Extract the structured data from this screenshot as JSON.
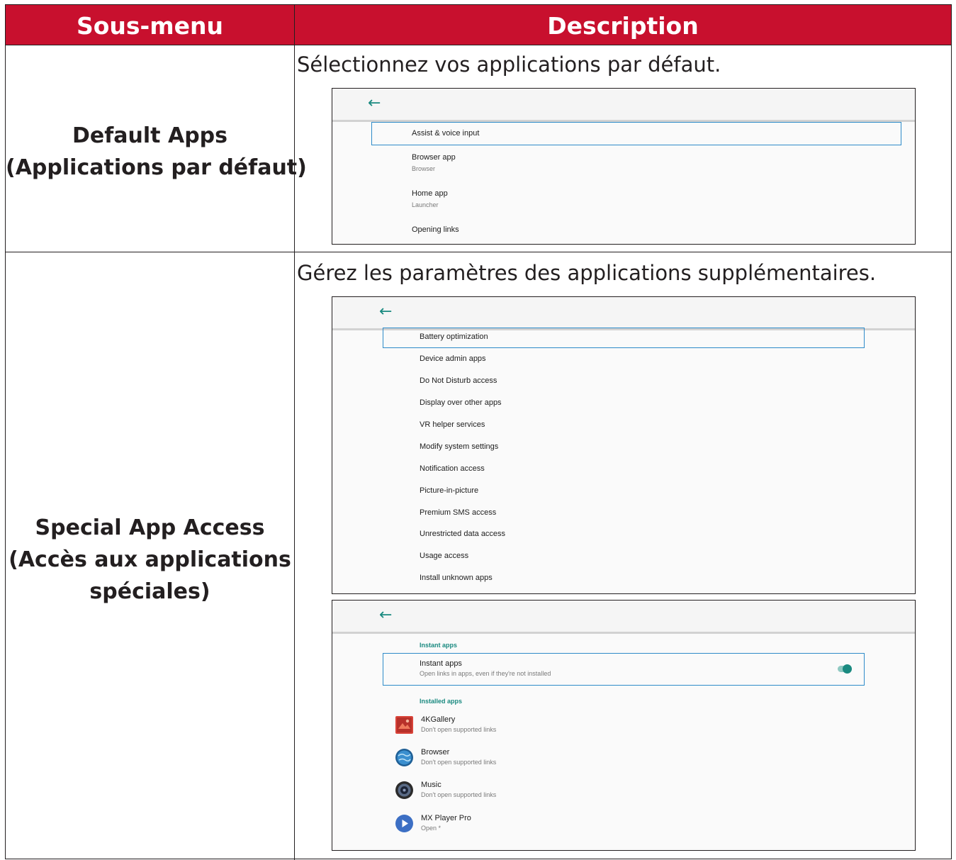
{
  "table": {
    "header": {
      "submenu": "Sous-menu",
      "description": "Description"
    },
    "rows": [
      {
        "label_lines": [
          "Default Apps",
          "(Applications par défaut)"
        ],
        "description": "Sélectionnez vos applications par défaut."
      },
      {
        "label_lines": [
          "Special App Access",
          "(Accès aux applications",
          "spéciales)"
        ],
        "description": "Gérez les paramètres des applications supplémentaires."
      }
    ]
  },
  "default_apps_screen": {
    "back_icon": "arrow-left-icon",
    "items": [
      {
        "title": "Assist & voice input",
        "summary": ""
      },
      {
        "title": "Browser app",
        "summary": "Browser"
      },
      {
        "title": "Home app",
        "summary": "Launcher"
      },
      {
        "title": "Opening links",
        "summary": ""
      }
    ]
  },
  "special_access_screen": {
    "back_icon": "arrow-left-icon",
    "items": [
      "Battery optimization",
      "Device admin apps",
      "Do Not Disturb access",
      "Display over other apps",
      "VR helper services",
      "Modify system settings",
      "Notification access",
      "Picture-in-picture",
      "Premium SMS access",
      "Unrestricted data access",
      "Usage access",
      "Install unknown apps"
    ]
  },
  "opening_links_screen": {
    "back_icon": "arrow-left-icon",
    "instant_category": "Instant apps",
    "instant_title": "Instant apps",
    "instant_summary": "Open links in apps, even if they're not installed",
    "instant_enabled": true,
    "installed_category": "Installed apps",
    "apps": [
      {
        "name": "4KGallery",
        "status": "Don't open supported links",
        "icon": "gallery-icon"
      },
      {
        "name": "Browser",
        "status": "Don't open supported links",
        "icon": "globe-icon"
      },
      {
        "name": "Music",
        "status": "Don't open supported links",
        "icon": "speaker-icon"
      },
      {
        "name": "MX Player Pro",
        "status": "Open *",
        "icon": "play-icon"
      }
    ]
  },
  "colors": {
    "header_red": "#c8102e",
    "accent_teal": "#1a8a80",
    "focus_blue": "#2e8bc9"
  }
}
